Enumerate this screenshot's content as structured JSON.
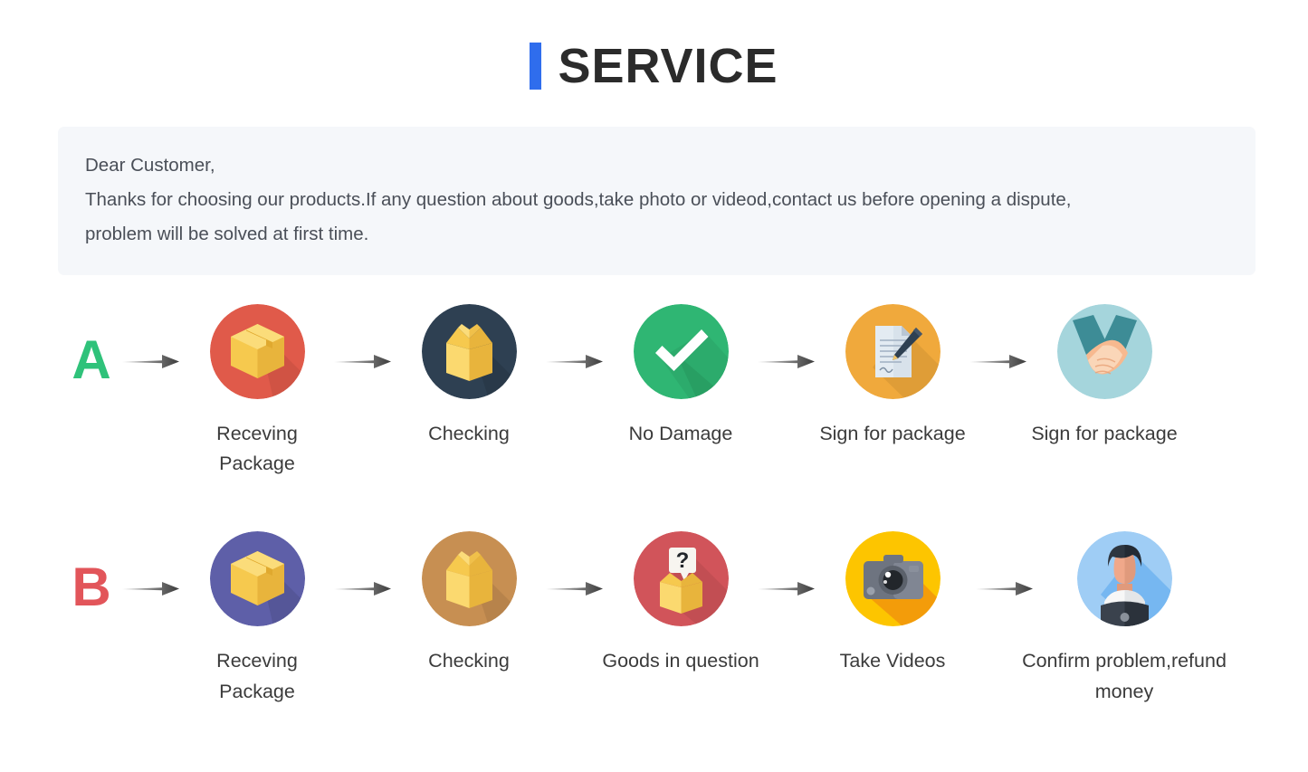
{
  "header": {
    "accent_color": "#2f6ded",
    "title": "SERVICE"
  },
  "notice": {
    "greeting": "Dear Customer,",
    "line2": "Thanks for choosing our products.If any question about goods,take photo or videod,contact us before opening a dispute,",
    "line3": "problem will be solved at first time.",
    "background_color": "#f5f7fa"
  },
  "flows": [
    {
      "letter": "A",
      "letter_color": "#2fc27a",
      "steps": [
        {
          "label": "Receving Package",
          "icon": "package-box-icon",
          "circle_color": "#e05a4a"
        },
        {
          "label": "Checking",
          "icon": "open-box-icon",
          "circle_color": "#2e4052"
        },
        {
          "label": "No Damage",
          "icon": "checkmark-icon",
          "circle_color": "#2fb673"
        },
        {
          "label": "Sign for package",
          "icon": "document-pen-icon",
          "circle_color": "#f0a93c"
        },
        {
          "label": "Sign for package",
          "icon": "handshake-icon",
          "circle_color": "#a5d5dc"
        }
      ]
    },
    {
      "letter": "B",
      "letter_color": "#e2555a",
      "steps": [
        {
          "label": "Receving Package",
          "icon": "package-box-icon",
          "circle_color": "#5e5fa8"
        },
        {
          "label": "Checking",
          "icon": "open-box-icon",
          "circle_color": "#c78f52"
        },
        {
          "label": "Goods in question",
          "icon": "box-question-icon",
          "circle_color": "#d1545a"
        },
        {
          "label": "Take Videos",
          "icon": "camera-icon",
          "circle_color": "#fdc500"
        },
        {
          "label": "Confirm problem,refund money",
          "icon": "person-avatar-icon",
          "circle_color": "#9fcdf5"
        }
      ]
    }
  ],
  "arrow": {
    "name": "arrow-right-icon",
    "color": "#4a4a4a"
  }
}
